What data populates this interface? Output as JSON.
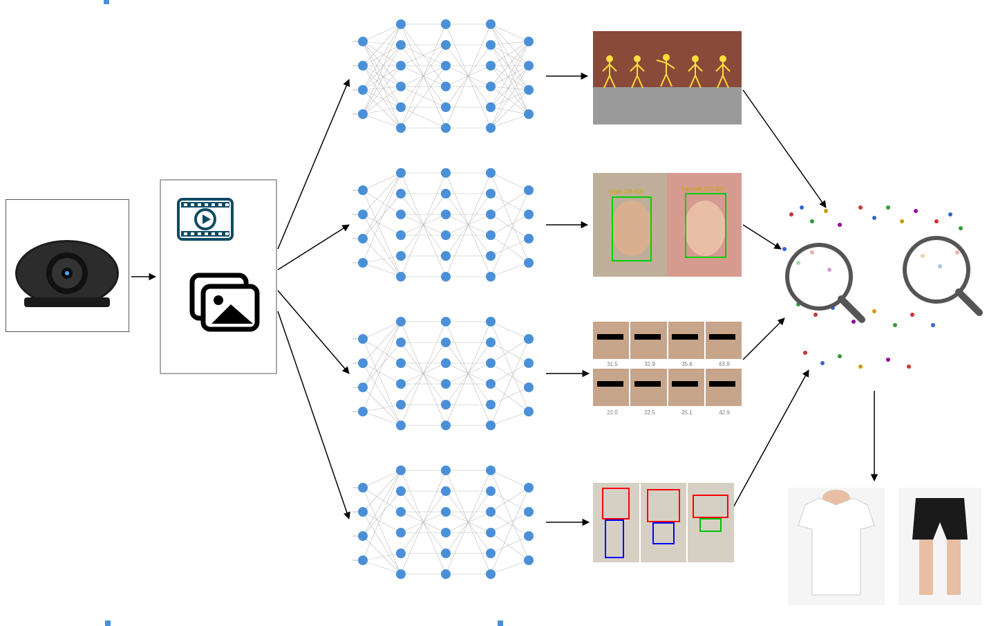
{
  "diagram": {
    "stages": {
      "camera": "Webcam input",
      "media": "Video / image frames",
      "networks": [
        "Pose estimation network",
        "Face+gender detection network",
        "Age regression network",
        "Clothing detection network"
      ],
      "outputs": {
        "pose": "Pose skeletons (5 people on bench)",
        "face_gender": {
          "left_box_label": "Male,(38-43)",
          "right_box_label": "Female,(25-32)"
        },
        "age_grid": {
          "top_row": [
            "31.5",
            "32.9",
            "35.6",
            "63.9"
          ],
          "bottom_row": [
            "22.0",
            "22.5",
            "25.1",
            "42.9"
          ]
        },
        "clothing": "Clothing bounding boxes"
      },
      "final": {
        "cluster": "Embedding scatter with magnifiers",
        "items": [
          "White T-shirt",
          "Black shorts"
        ]
      }
    }
  },
  "colors": {
    "node": "#4a90d9",
    "arrow": "#000000",
    "face_box": "#00d000",
    "cloth_box_red": "#ff0000",
    "cloth_box_blue": "#0000ff",
    "cloth_box_green": "#00c000"
  }
}
